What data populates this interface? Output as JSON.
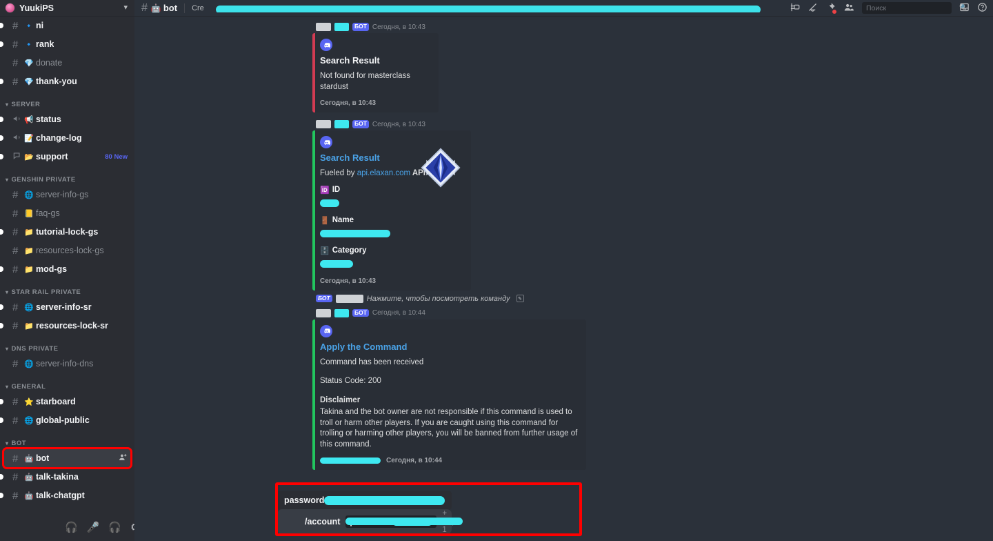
{
  "sidebar": {
    "server_name": "YuukiPS",
    "chevron_icon": "chevron-down-icon",
    "groups": [
      {
        "label": "",
        "channels": [
          {
            "emoji": "🔹",
            "name": "ni",
            "state": "unread",
            "unread_pill": true,
            "clipped": true
          },
          {
            "emoji": "🔹",
            "name": "rank",
            "state": "unread",
            "unread_pill": true
          },
          {
            "emoji": "💎",
            "name": "donate",
            "state": "read",
            "unread_pill": false
          },
          {
            "emoji": "💎",
            "name": "thank-you",
            "state": "unread",
            "unread_pill": true
          }
        ]
      },
      {
        "label": "SERVER",
        "channels": [
          {
            "icon": "announcement",
            "emoji": "📢",
            "name": "status",
            "state": "unread",
            "unread_pill": true
          },
          {
            "icon": "announcement",
            "emoji": "📝",
            "name": "change-log",
            "state": "unread",
            "unread_pill": true
          },
          {
            "icon": "forum",
            "emoji": "📂",
            "name": "support",
            "state": "unread",
            "unread_pill": true,
            "badge": "80 New"
          }
        ]
      },
      {
        "label": "GENSHIN PRIVATE",
        "channels": [
          {
            "emoji": "🌐",
            "name": "server-info-gs",
            "state": "read",
            "unread_pill": false
          },
          {
            "emoji": "📒",
            "name": "faq-gs",
            "state": "read",
            "unread_pill": false
          },
          {
            "emoji": "📁",
            "name": "tutorial-lock-gs",
            "state": "unread",
            "unread_pill": true
          },
          {
            "emoji": "📁",
            "name": "resources-lock-gs",
            "state": "read",
            "unread_pill": false
          },
          {
            "emoji": "📁",
            "name": "mod-gs",
            "state": "unread",
            "unread_pill": true
          }
        ]
      },
      {
        "label": "STAR RAIL PRIVATE",
        "channels": [
          {
            "emoji": "🌐",
            "name": "server-info-sr",
            "state": "unread",
            "unread_pill": true
          },
          {
            "emoji": "📁",
            "name": "resources-lock-sr",
            "state": "unread",
            "unread_pill": true
          }
        ]
      },
      {
        "label": "DNS PRIVATE",
        "channels": [
          {
            "emoji": "🌐",
            "name": "server-info-dns",
            "state": "read",
            "unread_pill": false
          }
        ]
      },
      {
        "label": "GENERAL",
        "channels": [
          {
            "emoji": "⭐",
            "name": "starboard",
            "state": "unread",
            "unread_pill": true
          },
          {
            "emoji": "🌐",
            "name": "global-public",
            "state": "unread",
            "unread_pill": true
          }
        ]
      },
      {
        "label": "BOT",
        "channels": [
          {
            "emoji": "🤖",
            "name": "bot",
            "state": "active",
            "unread_pill": false,
            "highlighted": true,
            "trailing_icon": "add-person-icon"
          },
          {
            "emoji": "🤖",
            "name": "talk-takina",
            "state": "unread",
            "unread_pill": true
          },
          {
            "emoji": "🤖",
            "name": "talk-chatgpt",
            "state": "unread",
            "unread_pill": true
          }
        ]
      }
    ],
    "voice_controls": [
      {
        "icon": "headset-icon"
      },
      {
        "icon": "microphone-icon"
      },
      {
        "icon": "deafen-headphones-icon"
      },
      {
        "icon": "gear-icon"
      }
    ]
  },
  "topbar": {
    "hash_icon": "hash-icon",
    "channel_emoji": "🤖",
    "channel_name": "bot",
    "topic_prefix": "Cre",
    "topic_redacted": true,
    "icons": [
      {
        "name": "threads-icon"
      },
      {
        "name": "notification-off-icon"
      },
      {
        "name": "pin-icon",
        "has_dot": true
      },
      {
        "name": "members-icon"
      }
    ],
    "search": {
      "placeholder": "Поиск",
      "value": "",
      "icon": "search-icon"
    },
    "inbox_icon": "inbox-icon",
    "help_icon": "help-icon"
  },
  "messages": [
    {
      "id": "msg-1",
      "author_redacted": true,
      "bot_tag": "БОТ",
      "timestamp": "Сегодня, в 10:43",
      "embed": {
        "accent": "#d13b52",
        "avatar_icon": "discord-icon",
        "title": "Search Result",
        "title_is_link": false,
        "description": "Not found for masterclass stardust",
        "footer_timestamp": "Сегодня, в 10:43"
      }
    },
    {
      "id": "msg-2",
      "author_redacted": true,
      "bot_tag": "БОТ",
      "timestamp": "Сегодня, в 10:43",
      "embed": {
        "accent": "#22c55e",
        "avatar_icon": "discord-icon",
        "title": "Search Result",
        "title_is_link": true,
        "description_prefix": "Fueled by ",
        "description_link": "api.elaxan.com",
        "description_suffix": " API",
        "thumbnail_icon": "primogem-icon",
        "fields": [
          {
            "emoji": "🆔",
            "name": "ID",
            "value_redacted": true,
            "value_width": 28
          },
          {
            "emoji": "🚪",
            "name": "Name",
            "value_redacted": true,
            "value_width": 102
          },
          {
            "emoji": "🗄️",
            "name": "Category",
            "value_redacted": true,
            "value_width": 48
          }
        ],
        "footer_timestamp": "Сегодня, в 10:43"
      }
    },
    {
      "id": "msg-3",
      "reply_tag": "БОТ",
      "reply_author_redacted": true,
      "reply_text": "Нажмите, чтобы посмотреть команду",
      "reply_icon": "slash-command-icon",
      "author_redacted": true,
      "bot_tag": "БОТ",
      "timestamp": "Сегодня, в 10:44",
      "embed": {
        "accent": "#22c55e",
        "avatar_icon": "discord-icon",
        "title": "Apply the Command",
        "title_is_link": true,
        "description": "Command has been received",
        "status_line": "Status Code: 200",
        "disclaimer_title": "Disclaimer",
        "disclaimer_body": "Takina and the bot owner are not responsible if this command is used to troll or harm other players. If you are caught using this command for trolling or harming other players, you will be banned from further usage of this command.",
        "footer_redacted": true,
        "footer_timestamp": "Сегодня, в 10:44"
      }
    }
  ],
  "composer": {
    "autocomplete": {
      "label": "password",
      "value_redacted": true,
      "highlighted": true
    },
    "command": "/account",
    "arg_redacted": true,
    "option_name": "password",
    "option_value_redacted": true,
    "more_label": "+ ещё 1",
    "highlight_color": "#ff0000"
  },
  "colors": {
    "sidebar_bg": "#2b2d33",
    "main_bg": "#2b313a",
    "embed_bg": "#292e36",
    "composer_bg": "#383d45",
    "accent_blurple": "#5865f2",
    "link_blue": "#4aa3e8",
    "redaction_cyan": "#3ee8f0",
    "highlight_red": "#ff0000",
    "embed_accent_crimson": "#d13b52",
    "embed_accent_green": "#22c55e",
    "badge_blue": "#5865f2"
  }
}
